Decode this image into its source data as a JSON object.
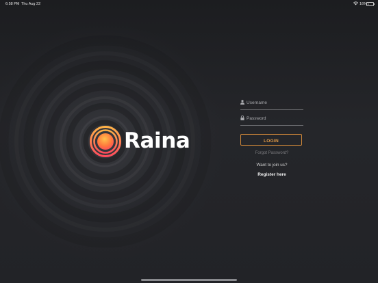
{
  "status_bar": {
    "time": "6:58 PM",
    "date": "Thu Aug 22",
    "battery_percent_text": "16%",
    "battery_level": 0.16,
    "wifi_icon": "wifi-icon",
    "battery_icon": "battery-icon"
  },
  "brand": {
    "name": "Raina",
    "mark_icon": "raina-logo-mark",
    "colors": {
      "accent_orange": "#e39b47",
      "mark_outer": "#ff5a4e",
      "mark_inner": "#ffb347"
    }
  },
  "login": {
    "username_placeholder": "Username",
    "username_icon": "user-icon",
    "password_placeholder": "Password",
    "password_icon": "lock-icon",
    "login_label": "LOGIN",
    "forgot_label": "Forgot Password?",
    "join_prompt": "Want to join us?",
    "register_label": "Register here"
  },
  "colors": {
    "background": "#1e1f22",
    "field_underline": "#6b6c70",
    "muted_text": "#7c7d81"
  }
}
